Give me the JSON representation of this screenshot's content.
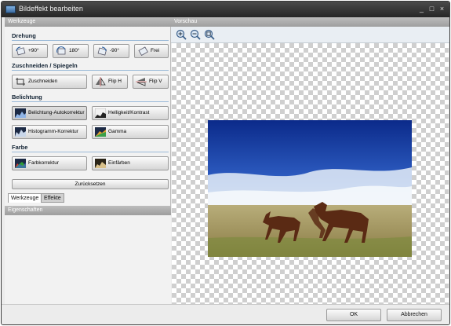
{
  "window": {
    "title": "Bildeffekt bearbeiten",
    "minimize": "_",
    "maximize": "□",
    "close": "×"
  },
  "left_panel": {
    "header": "Werkzeuge",
    "sections": {
      "drehung": {
        "title": "Drehung",
        "buttons": [
          "+90°",
          "180°",
          "-90°",
          "Frei"
        ]
      },
      "zuschneiden": {
        "title": "Zuschneiden / Spiegeln",
        "buttons": [
          "Zuschneiden",
          "Flip H",
          "Flip V"
        ]
      },
      "belichtung": {
        "title": "Belichtung",
        "buttons": [
          "Belichtung-Autokorrektur",
          "Helligkeit/Kontrast",
          "Histogramm-Korrektur",
          "Gamma"
        ]
      },
      "farbe": {
        "title": "Farbe",
        "buttons": [
          "Farbkorrektur",
          "Einfärben"
        ]
      }
    },
    "reset_button": "Zurücksetzen",
    "tabs": [
      "Werkzeuge",
      "Effekte"
    ],
    "properties_header": "Eigenschaften"
  },
  "preview": {
    "header": "Vorschau",
    "zoom_tools": [
      "zoom-in",
      "zoom-out",
      "zoom-fit"
    ]
  },
  "footer": {
    "ok": "OK",
    "cancel": "Abbrechen"
  },
  "colors": {
    "titlebar": "#2e2e2e",
    "accent": "#9bbad8",
    "panel_header": "#a8a8a8"
  }
}
